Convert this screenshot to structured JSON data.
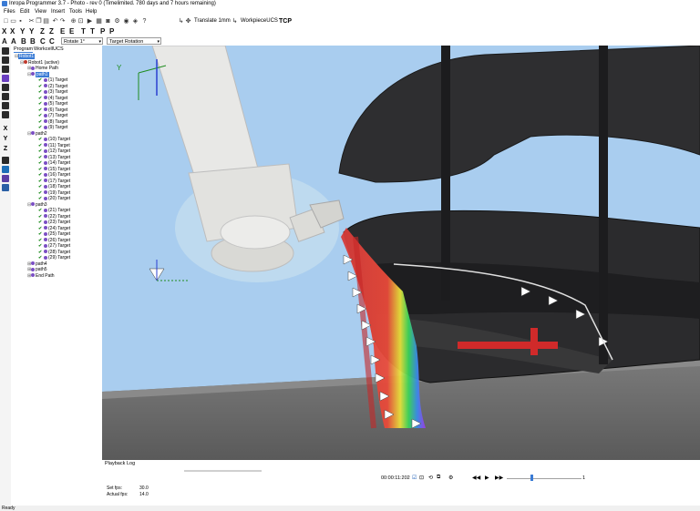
{
  "window": {
    "title": "Inropa Programmer 3.7 - Photo - rev 0  (Timelimited. 780 days and 7 hours remaining)"
  },
  "menu": [
    "Files",
    "Edit",
    "View",
    "Insert",
    "Tools",
    "Help"
  ],
  "toolbar": {
    "translate_label": "Translate 1mm",
    "ucs_label": "WorkpieceUCS",
    "tcp_label": "TCP"
  },
  "axis_buttons": [
    "X",
    "X",
    "Y",
    "Y",
    "Z",
    "Z",
    "E",
    "E",
    "T",
    "T",
    "P",
    "P"
  ],
  "axis_buttons_row2": [
    "A",
    "A",
    "B",
    "B",
    "C",
    "C"
  ],
  "combo_rotate": {
    "value": "Rotate 1°"
  },
  "combo_target": {
    "value": "Target Rotation"
  },
  "tree_tabs": [
    "Program",
    "Workcell",
    "UCS"
  ],
  "tree": {
    "root": "Robot1",
    "robot": "Robot1 (active)",
    "home": "Home Path",
    "path1": "path1",
    "path2": "path2",
    "path3": "path3",
    "path4": "path4",
    "path5": "path5",
    "end": "End Path",
    "group1": [
      "(1) Target",
      "(2) Target",
      "(3) Target",
      "(4) Target",
      "(5) Target",
      "(6) Target",
      "(7) Target",
      "(8) Target",
      "(9) Target"
    ],
    "group2": [
      "(10) Target",
      "(11) Target",
      "(12) Target",
      "(13) Target",
      "(14) Target",
      "(15) Target",
      "(16) Target",
      "(17) Target",
      "(18) Target",
      "(19) Target",
      "(20) Target"
    ],
    "group3": [
      "(21) Target",
      "(22) Target",
      "(23) Target",
      "(24) Target",
      "(25) Target",
      "(26) Target",
      "(27) Target",
      "(28) Target",
      "(29) Target"
    ]
  },
  "viewport": {
    "axis_y_label": "Y",
    "background": "#a9cdef"
  },
  "bottom": {
    "tabs": [
      "Playback",
      "Log"
    ],
    "time": "00:00:11:202",
    "frame": "1",
    "set_fps_label": "Set fps:",
    "set_fps_value": "30.0",
    "actual_fps_label": "Actual fps:",
    "actual_fps_value": "14.0"
  },
  "status": "Ready"
}
